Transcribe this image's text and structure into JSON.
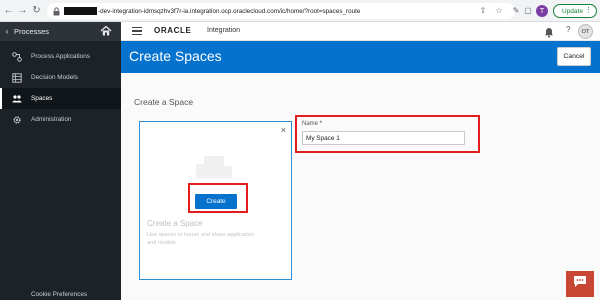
{
  "browser": {
    "url_text": "-dev-integration-idmsqzhv3f7r-ia.integration.ocp.oraclecloud.com/ic/home/?root=spaces_route",
    "profile_initial": "T",
    "update_label": "Update"
  },
  "sidebar": {
    "header": "Processes",
    "items": [
      {
        "label": "Process Applications",
        "icon": "process-app-icon"
      },
      {
        "label": "Decision Models",
        "icon": "decision-model-icon"
      },
      {
        "label": "Spaces",
        "icon": "spaces-icon",
        "active": true
      },
      {
        "label": "Administration",
        "icon": "gear-icon"
      }
    ],
    "footer": "Cookie Preferences"
  },
  "appbar": {
    "brand": "ORACLE",
    "product": "Integration",
    "avatar_initials": "OT"
  },
  "header": {
    "title": "Create Spaces",
    "cancel_label": "Cancel"
  },
  "main": {
    "section_title": "Create a Space",
    "card": {
      "create_label": "Create",
      "title": "Create a Space",
      "description": "Use spaces to house and share application and models"
    },
    "name_field": {
      "label": "Name",
      "required_marker": "*",
      "value": "My Space 1"
    }
  },
  "colors": {
    "accent_blue": "#0572ce",
    "sidebar_bg": "#1d2226",
    "highlight_red": "#e11d1d",
    "chat_red": "#c74634"
  }
}
